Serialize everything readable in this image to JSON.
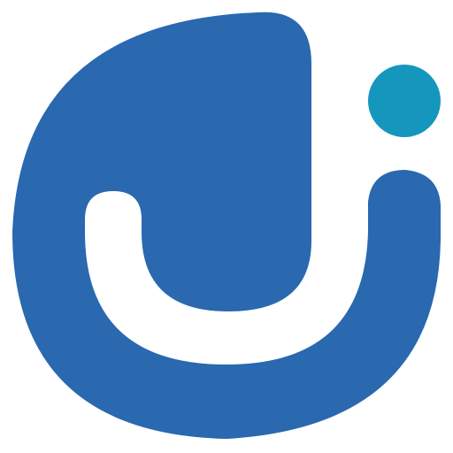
{
  "logo": {
    "icon": "letter-j-with-dot-icon",
    "colors": {
      "primary_blue": "#2A68B0",
      "dot_teal": "#1596BC",
      "background": "#FFFFFF"
    }
  }
}
